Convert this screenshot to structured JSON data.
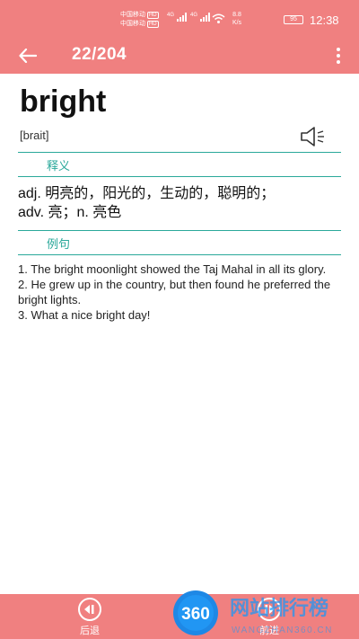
{
  "status_bar": {
    "carrier_1": "中国移动",
    "carrier_2": "中国移动",
    "hd_1": "HD",
    "hd_2": "HD",
    "net_1": "4G",
    "net_2": "4G",
    "speed_value": "8.8",
    "speed_unit": "K/s",
    "battery": "95",
    "time": "12:38"
  },
  "app_bar": {
    "counter": "22/204",
    "back_icon": "arrow-left-icon",
    "more_icon": "more-vertical-icon"
  },
  "entry": {
    "word": "bright",
    "phonetic": "[brait]",
    "speaker_icon": "speaker-icon",
    "meaning_header": "释义",
    "meaning_line_1": "adj. 明亮的，阳光的，生动的，聪明的；",
    "meaning_line_2": "adv. 亮；n. 亮色",
    "examples_header": "例句",
    "examples": [
      "1. The bright moonlight showed the Taj Mahal in all its glory.",
      "2. He grew up in the country, but then found he preferred the bright lights.",
      "3. What a nice bright day!"
    ]
  },
  "bottom_nav": {
    "prev_label": "后退",
    "next_label": "前进",
    "prev_icon": "rewind-icon",
    "next_icon": "forward-icon"
  },
  "watermark": {
    "badge": "360",
    "text": "网站排行榜",
    "url": "WANGZHAN360.CN"
  },
  "colors": {
    "accent": "#f08080",
    "section": "#2aa89a"
  }
}
